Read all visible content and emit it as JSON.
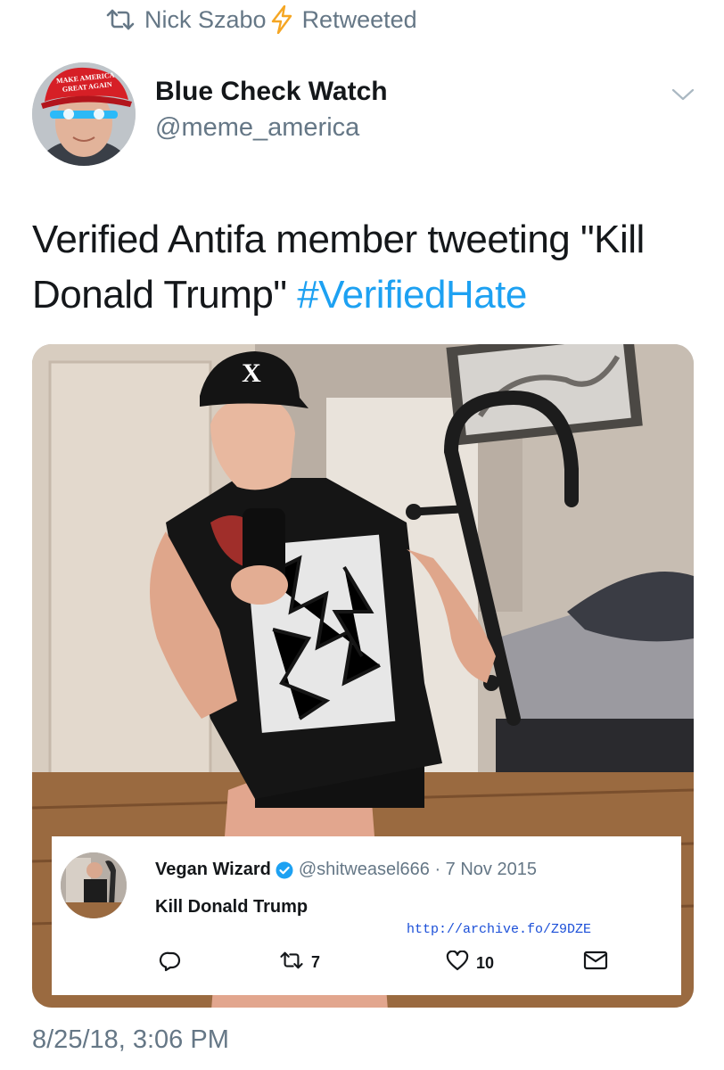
{
  "retweet": {
    "icon": "retweet-icon",
    "by": "Nick Szabo",
    "badge_icon": "lightning-icon",
    "label": "Retweeted"
  },
  "author": {
    "name": "Blue Check Watch",
    "handle": "@meme_america",
    "avatar_hat_text": [
      "MAKE AMERICA",
      "GREAT AGAIN"
    ]
  },
  "menu": {
    "icon": "chevron-down-icon"
  },
  "tweet": {
    "text": "Verified Antifa member tweeting \"Kill Donald Trump\" ",
    "hashtag": "#VerifiedHate"
  },
  "embedded_tweet": {
    "name": "Vegan Wizard",
    "verified_icon": "verified-badge-icon",
    "meta": "@shitweasel666 · 7 Nov 2015",
    "text": "Kill Donald Trump",
    "archive_url": "http://archive.fo/Z9DZE",
    "retweets": "7",
    "likes": "10",
    "reply_icon": "reply-icon",
    "like_icon": "heart-icon",
    "dm_icon": "envelope-icon"
  },
  "photo": {
    "cap_letter": "X"
  },
  "timestamp": "8/25/18, 3:06 PM",
  "colors": {
    "link": "#1da1f2",
    "secondary_text": "#657786",
    "primary_text": "#14171a",
    "lightning": "#f5a623"
  }
}
